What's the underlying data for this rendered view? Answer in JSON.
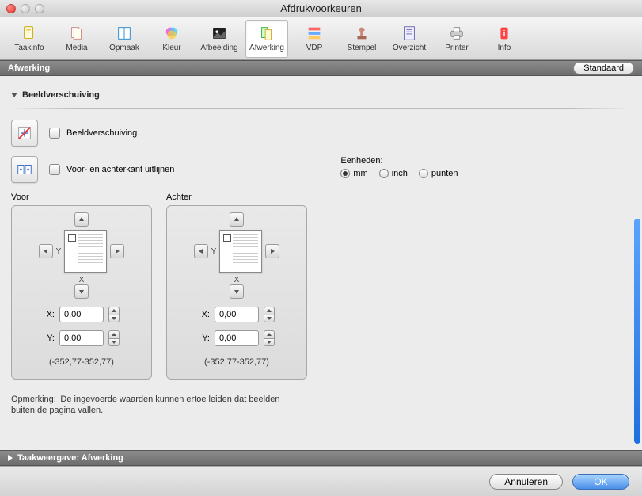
{
  "window": {
    "title": "Afdrukvoorkeuren"
  },
  "toolbar": {
    "items": [
      {
        "id": "taakinfo",
        "label": "Taakinfo"
      },
      {
        "id": "media",
        "label": "Media"
      },
      {
        "id": "opmaak",
        "label": "Opmaak"
      },
      {
        "id": "kleur",
        "label": "Kleur"
      },
      {
        "id": "afbeelding",
        "label": "Afbeelding"
      },
      {
        "id": "afwerking",
        "label": "Afwerking"
      },
      {
        "id": "vdp",
        "label": "VDP"
      },
      {
        "id": "stempel",
        "label": "Stempel"
      },
      {
        "id": "overzicht",
        "label": "Overzicht"
      },
      {
        "id": "printer",
        "label": "Printer"
      },
      {
        "id": "info",
        "label": "Info"
      }
    ],
    "selected": "afwerking"
  },
  "section": {
    "title": "Afwerking",
    "standard_btn": "Standaard"
  },
  "group": {
    "title": "Beeldverschuiving"
  },
  "options": {
    "image_shift_label": "Beeldverschuiving",
    "align_label": "Voor- en achterkant uitlijnen"
  },
  "units": {
    "label": "Eenheden:",
    "options": [
      "mm",
      "inch",
      "punten"
    ],
    "selected": "mm"
  },
  "panels": {
    "front": {
      "title": "Voor",
      "x_label": "X:",
      "y_label": "Y:",
      "x_value": "0,00",
      "y_value": "0,00",
      "range": "(-352,77-352,77)",
      "ax_y": "Y",
      "ax_x": "X"
    },
    "back": {
      "title": "Achter",
      "x_label": "X:",
      "y_label": "Y:",
      "x_value": "0,00",
      "y_value": "0,00",
      "range": "(-352,77-352,77)",
      "ax_y": "Y",
      "ax_x": "X"
    }
  },
  "note": {
    "prefix": "Opmerking:",
    "text": "De ingevoerde waarden kunnen ertoe leiden dat beelden buiten de pagina vallen."
  },
  "subsection": {
    "title": "Taakweergave: Afwerking"
  },
  "footer": {
    "cancel": "Annuleren",
    "ok": "OK"
  }
}
